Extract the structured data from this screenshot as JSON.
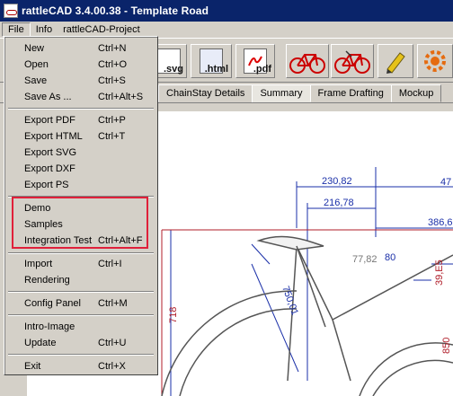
{
  "window": {
    "title": "rattleCAD  3.4.00.38 - Template Road"
  },
  "menubar": {
    "items": [
      "File",
      "Info",
      "rattleCAD-Project"
    ]
  },
  "toolbar": {
    "buttons": [
      {
        "icon": "svg-export-icon",
        "label": ".svg"
      },
      {
        "icon": "html-export-icon",
        "label": ".html"
      },
      {
        "icon": "pdf-export-icon",
        "label": ".pdf"
      },
      {
        "icon": "bike-red-icon",
        "label": ""
      },
      {
        "icon": "bike-red-2-icon",
        "label": ""
      },
      {
        "icon": "bike-red-3-icon",
        "label": ""
      },
      {
        "icon": "pencil-icon",
        "label": ""
      },
      {
        "icon": "gear-icon",
        "label": ""
      }
    ]
  },
  "tabs": [
    "ChainStay Details",
    "Summary",
    "Frame Drafting",
    "Mockup"
  ],
  "active_tab": "Summary",
  "file_menu": {
    "items": [
      {
        "label": "New",
        "shortcut": "Ctrl+N"
      },
      {
        "label": "Open",
        "shortcut": "Ctrl+O"
      },
      {
        "label": "Save",
        "shortcut": "Ctrl+S"
      },
      {
        "label": "Save As ...",
        "shortcut": "Ctrl+Alt+S"
      },
      {
        "label": "Export PDF",
        "shortcut": "Ctrl+P"
      },
      {
        "label": "Export HTML",
        "shortcut": "Ctrl+T"
      },
      {
        "label": "Export SVG",
        "shortcut": ""
      },
      {
        "label": "Export DXF",
        "shortcut": ""
      },
      {
        "label": "Export PS",
        "shortcut": ""
      },
      {
        "label": "Demo",
        "shortcut": ""
      },
      {
        "label": "Samples",
        "shortcut": ""
      },
      {
        "label": "Integration Test",
        "shortcut": "Ctrl+Alt+F"
      },
      {
        "label": "Import",
        "shortcut": "Ctrl+I"
      },
      {
        "label": "Rendering",
        "shortcut": ""
      },
      {
        "label": "Config Panel",
        "shortcut": "Ctrl+M"
      },
      {
        "label": "Intro-Image",
        "shortcut": ""
      },
      {
        "label": "Update",
        "shortcut": "Ctrl+U"
      },
      {
        "label": "Exit",
        "shortcut": "Ctrl+X"
      }
    ]
  },
  "drawing": {
    "dimensions": [
      "230,82",
      "216,78",
      "386,6",
      "77,82",
      "80",
      "750,01",
      "718",
      "850",
      "39,E5",
      "47"
    ]
  },
  "colors": {
    "titlebar": "#0a246a",
    "highlight_box": "#e0203a",
    "dimension_blue": "#1a2fa8",
    "dimension_red": "#b01e2a"
  }
}
